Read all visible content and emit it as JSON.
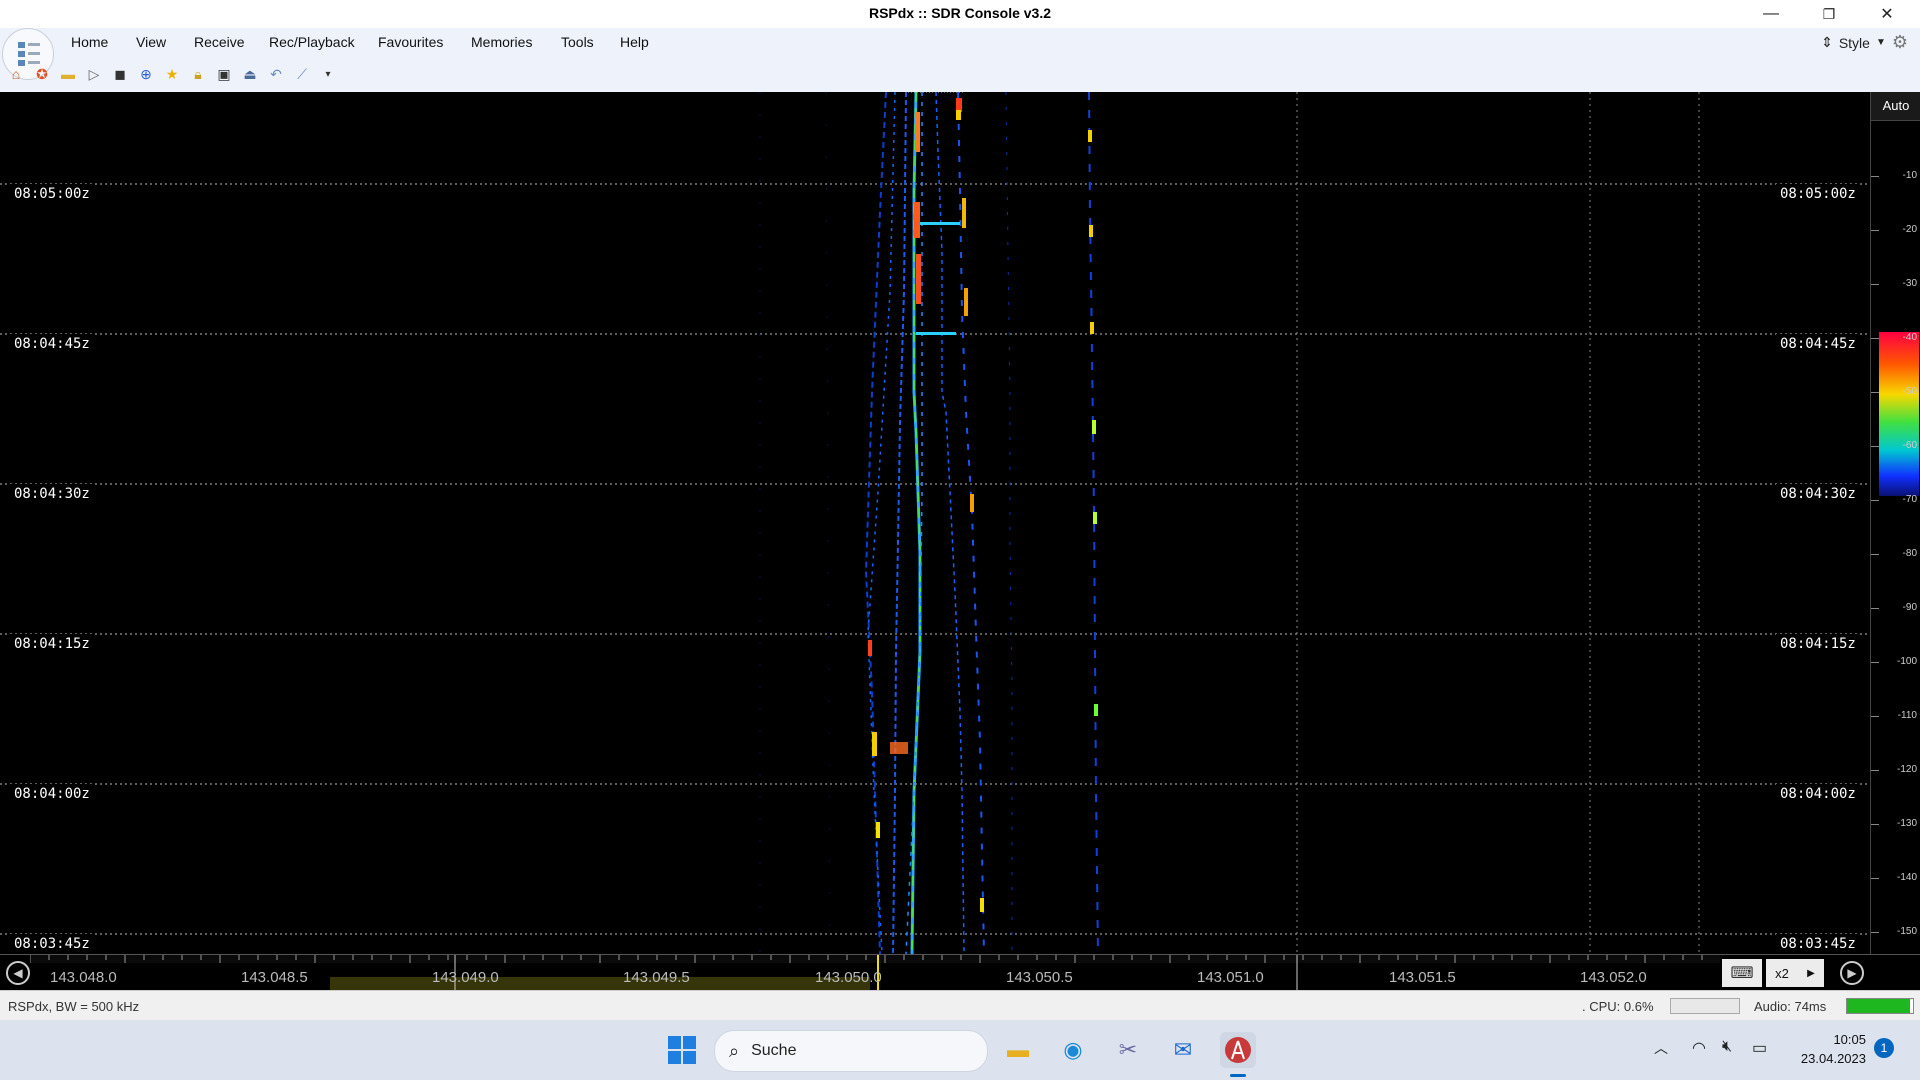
{
  "window": {
    "title": "RSPdx :: SDR Console v3.2",
    "minimize": "—",
    "restore": "❐",
    "close": "✕"
  },
  "menu": {
    "items": [
      "Home",
      "View",
      "Receive",
      "Rec/Playback",
      "Favourites",
      "Memories",
      "Tools",
      "Help"
    ],
    "style_label": "Style"
  },
  "waterfall": {
    "time_labels": [
      "08:05:00z",
      "08:04:45z",
      "08:04:30z",
      "08:04:15z",
      "08:04:00z",
      "08:03:45z"
    ],
    "auto_label": "Auto",
    "db_ticks": [
      "-10",
      "-20",
      "-30",
      "-40",
      "-50",
      "-60",
      "-70",
      "-80",
      "-90",
      "-100",
      "-110",
      "-120",
      "-130",
      "-140",
      "-150"
    ]
  },
  "freq_axis": {
    "labels": [
      "143.048.0",
      "143.048.5",
      "143.049.0",
      "143.049.5",
      "143.050.0",
      "143.050.5",
      "143.051.0",
      "143.051.5",
      "143.052.0"
    ],
    "zoom_label": "x2"
  },
  "status": {
    "left": "RSPdx, BW = 500 kHz",
    "cpu": ". CPU: 0.6%",
    "audio": "Audio: 74ms",
    "audio_bar_color": "#1fb71f"
  },
  "taskbar": {
    "search_placeholder": "Suche",
    "time": "10:05",
    "date": "23.04.2023",
    "notification_count": "1"
  },
  "colors": {
    "accent": "#0067c0",
    "waterfall_bg": "#000000"
  }
}
